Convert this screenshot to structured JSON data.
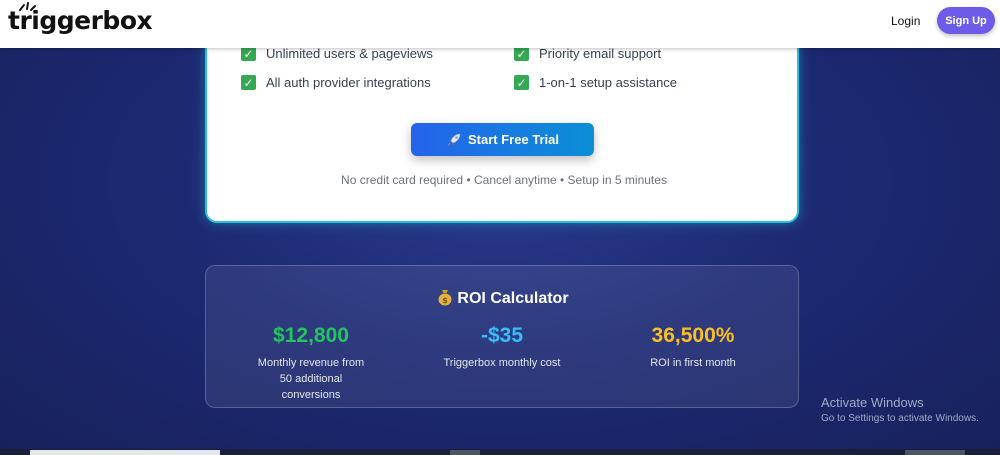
{
  "header": {
    "logo": "triggerbox",
    "login_label": "Login",
    "signup_label": "Sign Up"
  },
  "pricing": {
    "features": [
      "Unlimited users & pageviews",
      "Priority email support",
      "All auth provider integrations",
      "1-on-1 setup assistance"
    ],
    "cta_label": "Start Free Trial",
    "fineprint": "No credit card required • Cancel anytime • Setup in 5 minutes"
  },
  "roi": {
    "title": "ROI Calculator",
    "stats": [
      {
        "value": "$12,800",
        "label": "Monthly revenue from 50 additional conversions",
        "color": "#22c55e"
      },
      {
        "value": "-$35",
        "label": "Triggerbox monthly cost",
        "color": "#38bdf8"
      },
      {
        "value": "36,500%",
        "label": "ROI in first month",
        "color": "#fbbf24"
      }
    ]
  },
  "watermark": {
    "line1": "Activate Windows",
    "line2": "Go to Settings to activate Windows."
  },
  "colors": {
    "brand_purple": "#6c5ce7",
    "card_border": "#22c2dc",
    "check_green": "#34a853"
  },
  "icons": [
    "spark-icon",
    "checkmark-icon",
    "rocket-icon",
    "money-bag-icon"
  ]
}
